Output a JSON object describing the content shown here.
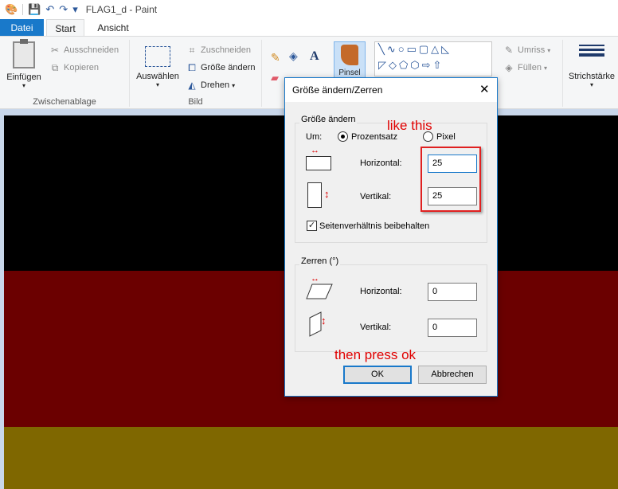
{
  "window": {
    "title": "FLAG1_d - Paint"
  },
  "tabs": [
    {
      "label": "Datei"
    },
    {
      "label": "Start"
    },
    {
      "label": "Ansicht"
    }
  ],
  "ribbon": {
    "clipboard": {
      "paste": "Einfügen",
      "cut": "Ausschneiden",
      "copy": "Kopieren",
      "group": "Zwischenablage"
    },
    "image": {
      "select": "Auswählen",
      "crop": "Zuschneiden",
      "resize": "Größe ändern",
      "rotate": "Drehen",
      "group": "Bild"
    },
    "tools": {
      "text_tool": "A",
      "brush": "Pinsel"
    },
    "shapes": {
      "outline": "Umriss",
      "fill": "Füllen"
    },
    "stroke": {
      "label": "Strichstärke"
    }
  },
  "dialog": {
    "title": "Größe ändern/Zerren",
    "close": "✕",
    "resize": {
      "legend": "Größe ändern",
      "by_label": "Um:",
      "percent_label": "Prozentsatz",
      "pixel_label": "Pixel",
      "selected": "Prozentsatz",
      "horizontal_label": "Horizontal:",
      "horizontal_value": "25",
      "vertical_label": "Vertikal:",
      "vertical_value": "25",
      "keep_ratio_label": "Seitenverhältnis beibehalten",
      "keep_ratio_checked": true
    },
    "skew": {
      "legend": "Zerren (°)",
      "horizontal_label": "Horizontal:",
      "horizontal_value": "0",
      "vertical_label": "Vertikal:",
      "vertical_value": "0"
    },
    "ok": "OK",
    "cancel": "Abbrechen"
  },
  "annotations": {
    "like_this": "like this",
    "then_press_ok": "then press ok"
  },
  "canvas": {
    "stripes": [
      "#000000",
      "#6b0000",
      "#7f6700"
    ]
  }
}
